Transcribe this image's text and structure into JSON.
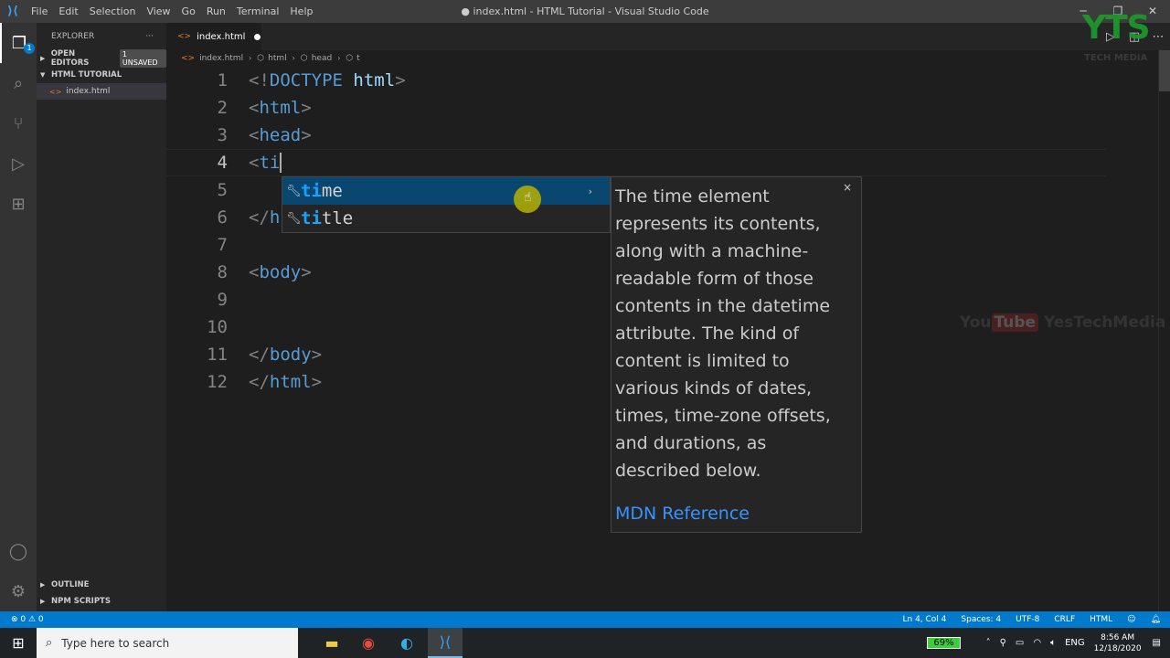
{
  "titlebar": {
    "menu": [
      "File",
      "Edit",
      "Selection",
      "View",
      "Go",
      "Run",
      "Terminal",
      "Help"
    ],
    "window_title": "● index.html - HTML Tutorial - Visual Studio Code"
  },
  "activity": {
    "explorer_badge": "1"
  },
  "sidebar": {
    "title": "EXPLORER",
    "more": "···",
    "open_editors": "OPEN EDITORS",
    "unsaved_badge": "1 UNSAVED",
    "folder": "HTML TUTORIAL",
    "file": "index.html",
    "outline": "OUTLINE",
    "npm_scripts": "NPM SCRIPTS"
  },
  "tab": {
    "label": "index.html"
  },
  "breadcrumb": {
    "file": "index.html",
    "c1": "html",
    "c2": "head",
    "c3": "t"
  },
  "editor": {
    "line_numbers": [
      "1",
      "2",
      "3",
      "4",
      "5",
      "6",
      "7",
      "8",
      "9",
      "10",
      "11",
      "12"
    ],
    "l1_open": "<!",
    "l1_tag": "DOCTYPE",
    "l1_attr": "html",
    "l1_close": ">",
    "l2_open": "<",
    "l2_tag": "html",
    "l2_close": ">",
    "l3_open": "<",
    "l3_tag": "head",
    "l3_close": ">",
    "l4_open": "<",
    "l4_tag": "ti",
    "l6_open": "</",
    "l6_tag": "h",
    "l8_open": "<",
    "l8_tag": "body",
    "l8_close": ">",
    "l11_open": "</",
    "l11_tag": "body",
    "l11_close": ">",
    "l12_open": "</",
    "l12_tag": "html",
    "l12_close": ">"
  },
  "suggest": {
    "items": [
      {
        "match": "ti",
        "rest": "me"
      },
      {
        "match": "ti",
        "rest": "tle"
      }
    ],
    "more": "›"
  },
  "docs": {
    "close": "×",
    "description": "The time element represents its contents, along with a machine-readable form of those contents in the datetime attribute. The kind of content is limited to various kinds of dates, times, time-zone offsets, and durations, as described below.",
    "reference_link": "MDN Reference"
  },
  "watermark": {
    "logo": "YTS",
    "sub": "TECH MEDIA",
    "yt_you": "You",
    "yt_tube": "Tube",
    "yt_channel": "YesTechMedia"
  },
  "status": {
    "problems": "⊗ 0 ⚠ 0",
    "position": "Ln 4, Col 4",
    "spaces": "Spaces: 4",
    "encoding": "UTF-8",
    "eol": "CRLF",
    "language": "HTML"
  },
  "taskbar": {
    "search_placeholder": "Type here to search",
    "battery": "69%",
    "lang": "ENG",
    "time": "8:56 AM",
    "date": "12/18/2020"
  },
  "colors": {
    "accent": "#007acc",
    "tag": "#569cd6",
    "match": "#18a3ff",
    "selected": "#094771",
    "link": "#3794ff"
  }
}
